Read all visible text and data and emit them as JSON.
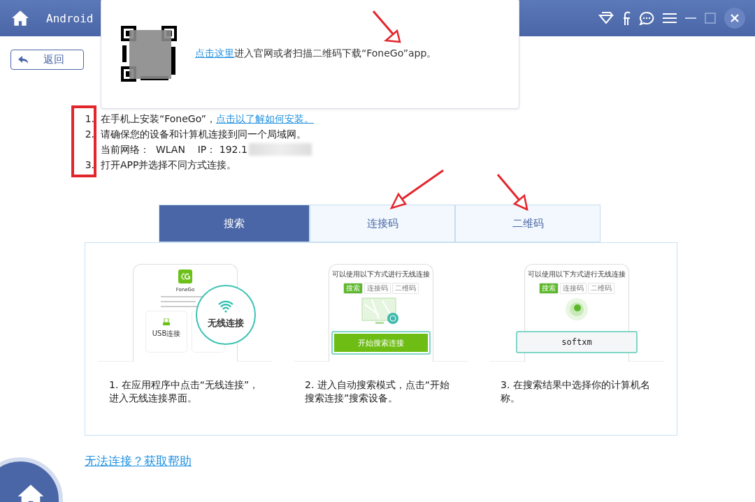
{
  "header": {
    "title": "Android"
  },
  "popup": {
    "link": "点击这里",
    "text": "进入官网或者扫描二维码下载“FoneGo”app。"
  },
  "back_button": {
    "label": "返回"
  },
  "steps": [
    {
      "number": "1.",
      "text": "在手机上安装“FoneGo”，",
      "link": "点击以了解如何安装。"
    },
    {
      "number": "2.",
      "text": "请确保您的设备和计算机连接到同一个局域网。",
      "detail": "当前网络：  WLAN    IP： 192.1"
    },
    {
      "number": "3.",
      "text": "打开APP并选择不同方式连接。"
    }
  ],
  "tabs": [
    {
      "label": "搜索",
      "selected": true
    },
    {
      "label": "连接码",
      "selected": false
    },
    {
      "label": "二维码",
      "selected": false
    }
  ],
  "methods": [
    {
      "kind": "wireless",
      "app_name": "FoneGo",
      "option": "USB连接",
      "bubble": "无线连接",
      "caption": "1. 在应用程序中点击“无线连接”，进入无线连接界面。"
    },
    {
      "kind": "search",
      "heading": "可以使用以下方式进行无线连接",
      "mini_tabs": [
        {
          "label": "搜索",
          "selected": true
        },
        {
          "label": "连接码",
          "selected": false
        },
        {
          "label": "二维码",
          "selected": false
        }
      ],
      "action": "开始搜索连接",
      "caption": "2. 进入自动搜索模式，点击“开始搜索连接”搜索设备。"
    },
    {
      "kind": "result",
      "heading": "可以使用以下方式进行无线连接",
      "mini_tabs": [
        {
          "label": "搜索",
          "selected": true
        },
        {
          "label": "连接码",
          "selected": false
        },
        {
          "label": "二维码",
          "selected": false
        }
      ],
      "device": "softxm",
      "caption": "3. 在搜索结果中选择你的计算机名称。"
    }
  ],
  "help_link": "无法连接？获取帮助"
}
